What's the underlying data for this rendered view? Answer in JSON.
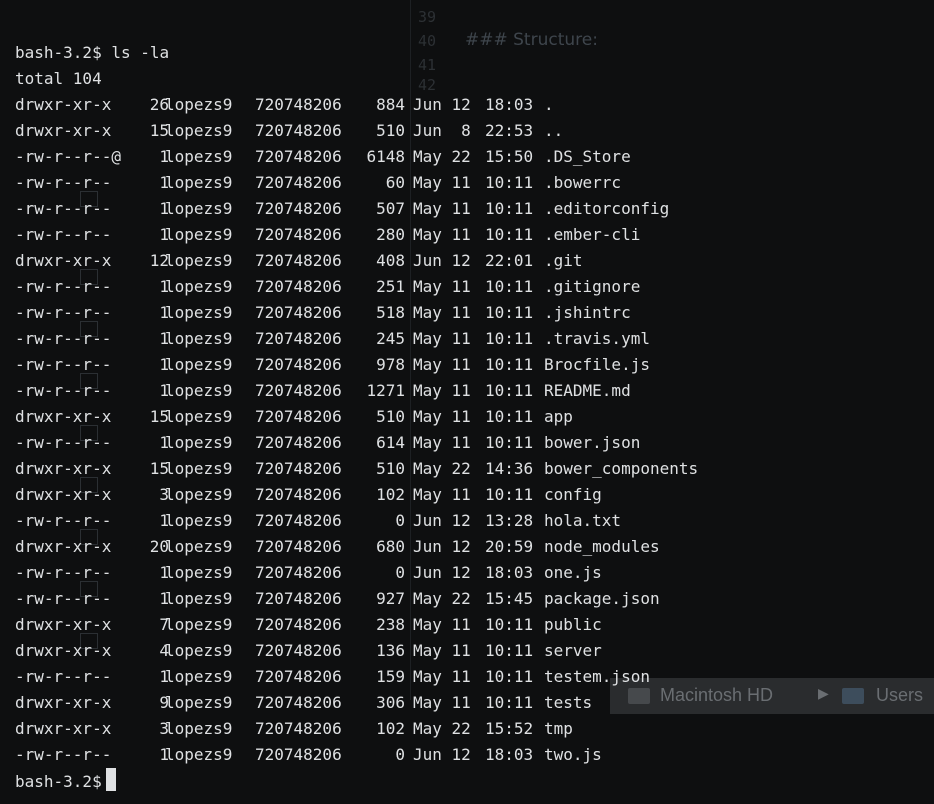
{
  "terminal": {
    "command_prompt": "bash-3.2$",
    "command": "ls -la",
    "total_line": "total 104",
    "entries": [
      {
        "perms": "drwxr-xr-x",
        "links": "26",
        "owner": "lopezs9",
        "group": "720748206",
        "size": "884",
        "date": "Jun 12",
        "time": "18:03",
        "name": "."
      },
      {
        "perms": "drwxr-xr-x",
        "links": "15",
        "owner": "lopezs9",
        "group": "720748206",
        "size": "510",
        "date": "Jun  8",
        "time": "22:53",
        "name": ".."
      },
      {
        "perms": "-rw-r--r--@",
        "links": "1",
        "owner": "lopezs9",
        "group": "720748206",
        "size": "6148",
        "date": "May 22",
        "time": "15:50",
        "name": ".DS_Store"
      },
      {
        "perms": "-rw-r--r--",
        "links": "1",
        "owner": "lopezs9",
        "group": "720748206",
        "size": "60",
        "date": "May 11",
        "time": "10:11",
        "name": ".bowerrc"
      },
      {
        "perms": "-rw-r--r--",
        "links": "1",
        "owner": "lopezs9",
        "group": "720748206",
        "size": "507",
        "date": "May 11",
        "time": "10:11",
        "name": ".editorconfig"
      },
      {
        "perms": "-rw-r--r--",
        "links": "1",
        "owner": "lopezs9",
        "group": "720748206",
        "size": "280",
        "date": "May 11",
        "time": "10:11",
        "name": ".ember-cli"
      },
      {
        "perms": "drwxr-xr-x",
        "links": "12",
        "owner": "lopezs9",
        "group": "720748206",
        "size": "408",
        "date": "Jun 12",
        "time": "22:01",
        "name": ".git"
      },
      {
        "perms": "-rw-r--r--",
        "links": "1",
        "owner": "lopezs9",
        "group": "720748206",
        "size": "251",
        "date": "May 11",
        "time": "10:11",
        "name": ".gitignore"
      },
      {
        "perms": "-rw-r--r--",
        "links": "1",
        "owner": "lopezs9",
        "group": "720748206",
        "size": "518",
        "date": "May 11",
        "time": "10:11",
        "name": ".jshintrc"
      },
      {
        "perms": "-rw-r--r--",
        "links": "1",
        "owner": "lopezs9",
        "group": "720748206",
        "size": "245",
        "date": "May 11",
        "time": "10:11",
        "name": ".travis.yml"
      },
      {
        "perms": "-rw-r--r--",
        "links": "1",
        "owner": "lopezs9",
        "group": "720748206",
        "size": "978",
        "date": "May 11",
        "time": "10:11",
        "name": "Brocfile.js"
      },
      {
        "perms": "-rw-r--r--",
        "links": "1",
        "owner": "lopezs9",
        "group": "720748206",
        "size": "1271",
        "date": "May 11",
        "time": "10:11",
        "name": "README.md"
      },
      {
        "perms": "drwxr-xr-x",
        "links": "15",
        "owner": "lopezs9",
        "group": "720748206",
        "size": "510",
        "date": "May 11",
        "time": "10:11",
        "name": "app"
      },
      {
        "perms": "-rw-r--r--",
        "links": "1",
        "owner": "lopezs9",
        "group": "720748206",
        "size": "614",
        "date": "May 11",
        "time": "10:11",
        "name": "bower.json"
      },
      {
        "perms": "drwxr-xr-x",
        "links": "15",
        "owner": "lopezs9",
        "group": "720748206",
        "size": "510",
        "date": "May 22",
        "time": "14:36",
        "name": "bower_components"
      },
      {
        "perms": "drwxr-xr-x",
        "links": "3",
        "owner": "lopezs9",
        "group": "720748206",
        "size": "102",
        "date": "May 11",
        "time": "10:11",
        "name": "config"
      },
      {
        "perms": "-rw-r--r--",
        "links": "1",
        "owner": "lopezs9",
        "group": "720748206",
        "size": "0",
        "date": "Jun 12",
        "time": "13:28",
        "name": "hola.txt"
      },
      {
        "perms": "drwxr-xr-x",
        "links": "20",
        "owner": "lopezs9",
        "group": "720748206",
        "size": "680",
        "date": "Jun 12",
        "time": "20:59",
        "name": "node_modules"
      },
      {
        "perms": "-rw-r--r--",
        "links": "1",
        "owner": "lopezs9",
        "group": "720748206",
        "size": "0",
        "date": "Jun 12",
        "time": "18:03",
        "name": "one.js"
      },
      {
        "perms": "-rw-r--r--",
        "links": "1",
        "owner": "lopezs9",
        "group": "720748206",
        "size": "927",
        "date": "May 22",
        "time": "15:45",
        "name": "package.json"
      },
      {
        "perms": "drwxr-xr-x",
        "links": "7",
        "owner": "lopezs9",
        "group": "720748206",
        "size": "238",
        "date": "May 11",
        "time": "10:11",
        "name": "public"
      },
      {
        "perms": "drwxr-xr-x",
        "links": "4",
        "owner": "lopezs9",
        "group": "720748206",
        "size": "136",
        "date": "May 11",
        "time": "10:11",
        "name": "server"
      },
      {
        "perms": "-rw-r--r--",
        "links": "1",
        "owner": "lopezs9",
        "group": "720748206",
        "size": "159",
        "date": "May 11",
        "time": "10:11",
        "name": "testem.json"
      },
      {
        "perms": "drwxr-xr-x",
        "links": "9",
        "owner": "lopezs9",
        "group": "720748206",
        "size": "306",
        "date": "May 11",
        "time": "10:11",
        "name": "tests"
      },
      {
        "perms": "drwxr-xr-x",
        "links": "3",
        "owner": "lopezs9",
        "group": "720748206",
        "size": "102",
        "date": "May 22",
        "time": "15:52",
        "name": "tmp"
      },
      {
        "perms": "-rw-r--r--",
        "links": "1",
        "owner": "lopezs9",
        "group": "720748206",
        "size": "0",
        "date": "Jun 12",
        "time": "18:03",
        "name": "two.js"
      }
    ],
    "final_prompt": "bash-3.2$"
  },
  "background_editor": {
    "line_numbers": [
      "39",
      "40",
      "41",
      "42"
    ],
    "heading": "### Structure:"
  },
  "background_finder": {
    "disk_label": "Macintosh HD",
    "separator": "▶",
    "folder_label": "Users"
  },
  "colors": {
    "background": "#0e0f10",
    "text": "#dfe1e3"
  }
}
